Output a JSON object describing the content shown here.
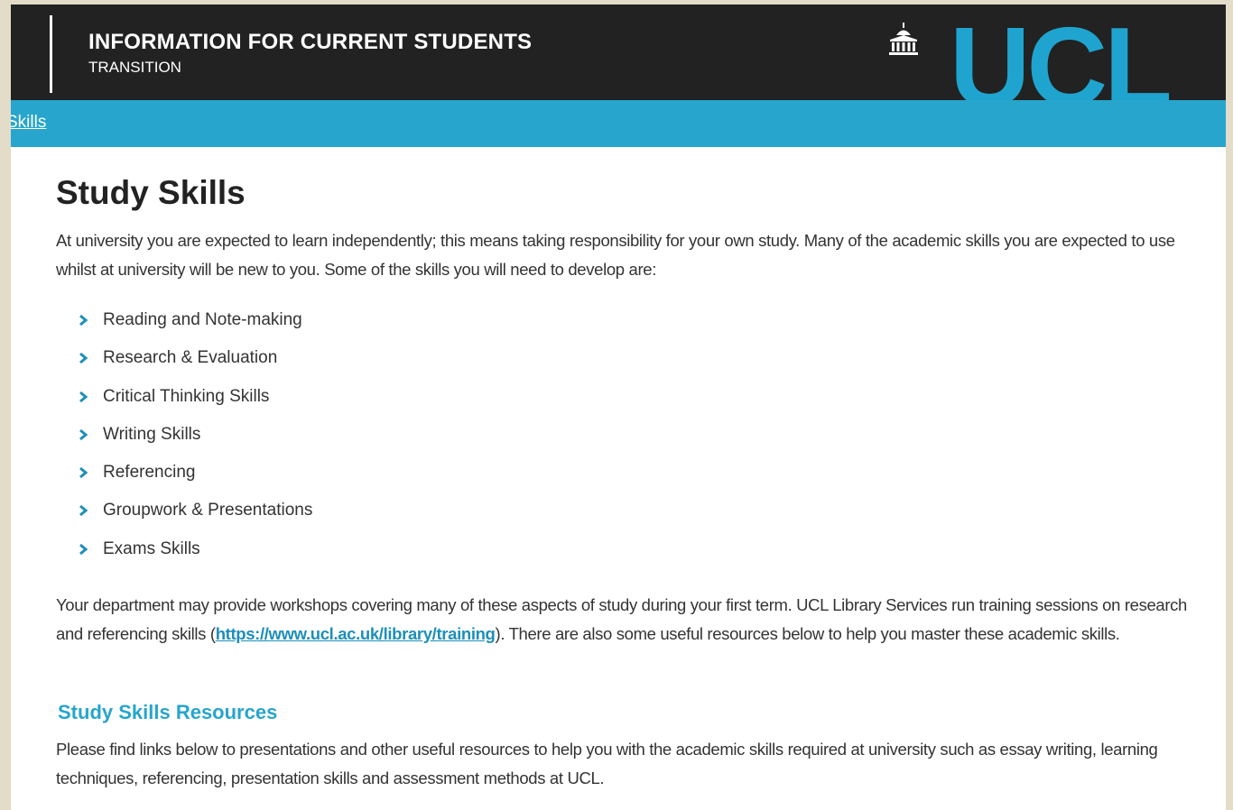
{
  "header": {
    "title": "INFORMATION FOR CURRENT STUDENTS",
    "subtitle": "TRANSITION",
    "logo_text": "UCL",
    "logo_icon": "portico-icon",
    "background_color": "#222222",
    "logo_color": "#1fa4cf"
  },
  "nav": {
    "breadcrumb_label": "Skills",
    "background_color": "#27a5cc"
  },
  "main": {
    "title": "Study Skills",
    "intro": "At university you are expected to learn independently; this means taking responsibility for your own study. Many of the academic skills you are expected to use whilst at university will be new to you. Some of the skills you will need to develop are:",
    "skills": [
      "Reading and Note-making",
      "Research & Evaluation",
      "Critical Thinking Skills",
      "Writing Skills",
      "Referencing",
      "Groupwork & Presentations",
      "Exams Skills"
    ],
    "bullet_icon": "chevron-right-icon",
    "department_text_before": "Your department may provide workshops covering many of these aspects of study during your first term. UCL Library Services run training sessions on research and referencing skills (",
    "department_link": "https://www.ucl.ac.uk/library/training",
    "department_text_after": "). There are also some useful resources below to help you master these academic skills.",
    "resources_heading": "Study Skills Resources",
    "resources_text": "Please find links below to presentations and other useful resources to help you with the academic skills required at university such as essay writing, learning techniques, referencing, presentation skills and assessment methods at UCL."
  }
}
